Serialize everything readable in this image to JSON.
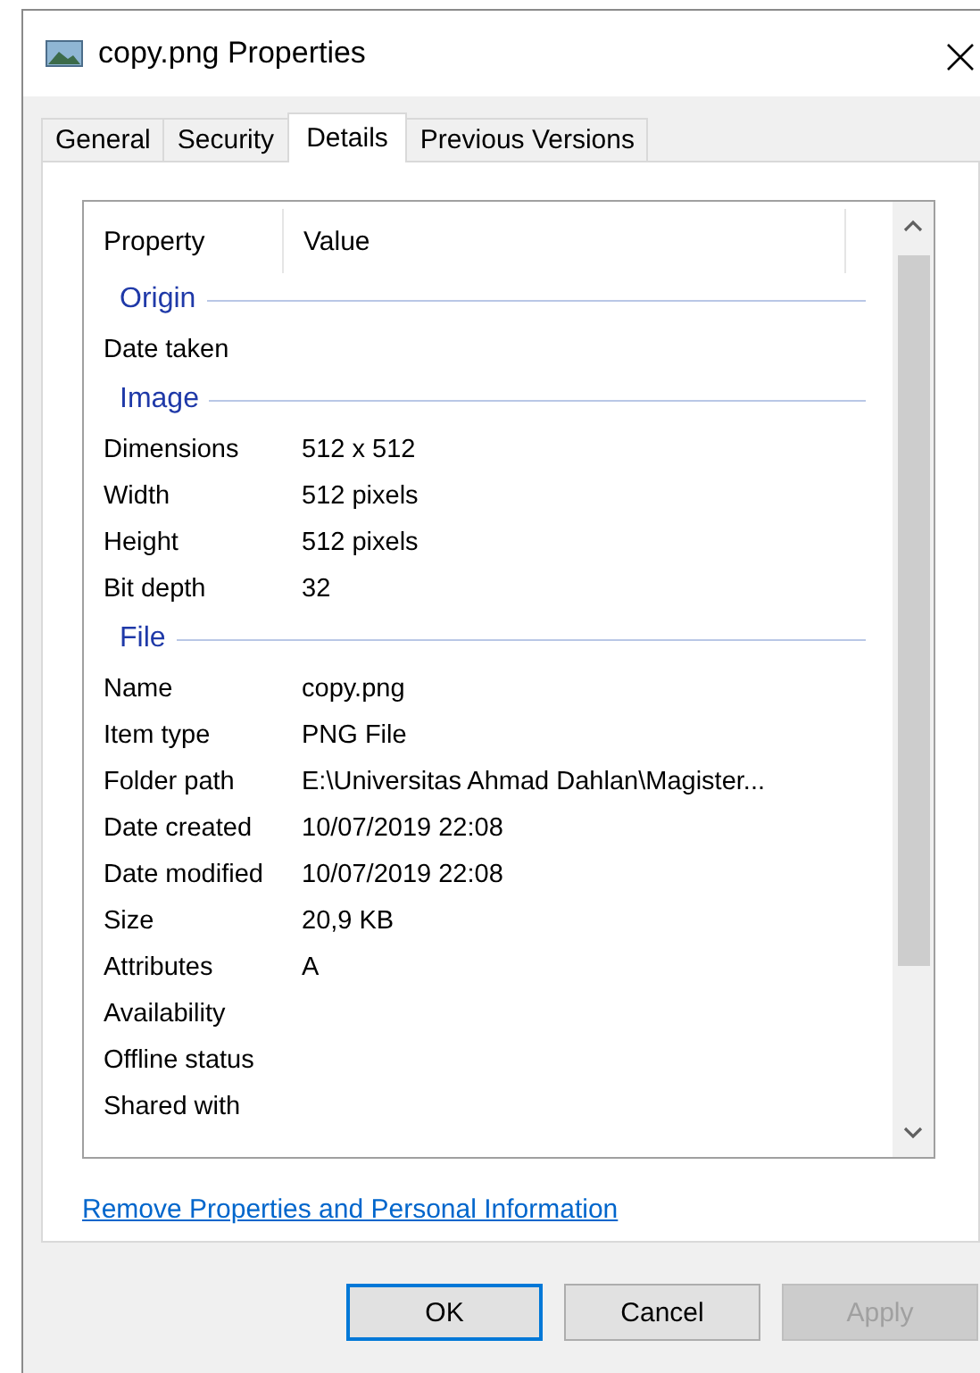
{
  "window": {
    "title": "copy.png Properties"
  },
  "tabs": [
    {
      "label": "General",
      "selected": false
    },
    {
      "label": "Security",
      "selected": false
    },
    {
      "label": "Details",
      "selected": true
    },
    {
      "label": "Previous Versions",
      "selected": false
    }
  ],
  "details": {
    "columns": [
      "Property",
      "Value"
    ],
    "groups": [
      {
        "title": "Origin",
        "rows": [
          {
            "property": "Date taken",
            "value": ""
          }
        ]
      },
      {
        "title": "Image",
        "rows": [
          {
            "property": "Dimensions",
            "value": "512 x 512"
          },
          {
            "property": "Width",
            "value": "512 pixels"
          },
          {
            "property": "Height",
            "value": "512 pixels"
          },
          {
            "property": "Bit depth",
            "value": "32"
          }
        ]
      },
      {
        "title": "File",
        "rows": [
          {
            "property": "Name",
            "value": "copy.png"
          },
          {
            "property": "Item type",
            "value": "PNG File"
          },
          {
            "property": "Folder path",
            "value": "E:\\Universitas Ahmad Dahlan\\Magister..."
          },
          {
            "property": "Date created",
            "value": "10/07/2019 22:08"
          },
          {
            "property": "Date modified",
            "value": "10/07/2019 22:08"
          },
          {
            "property": "Size",
            "value": "20,9 KB"
          },
          {
            "property": "Attributes",
            "value": "A"
          },
          {
            "property": "Availability",
            "value": ""
          },
          {
            "property": "Offline status",
            "value": ""
          },
          {
            "property": "Shared with",
            "value": ""
          }
        ]
      }
    ]
  },
  "link": "Remove Properties and Personal Information",
  "buttons": [
    {
      "label": "OK",
      "kind": "default"
    },
    {
      "label": "Cancel",
      "kind": "normal"
    },
    {
      "label": "Apply",
      "kind": "disabled"
    }
  ]
}
